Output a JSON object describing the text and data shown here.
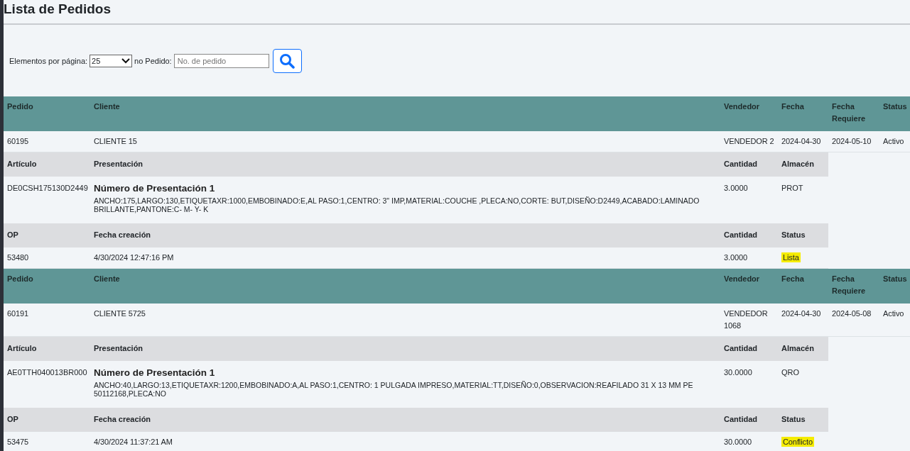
{
  "page_title": "Lista de Pedidos",
  "filters": {
    "per_page_label": "Elementos por página:",
    "per_page_value": "25",
    "order_label": "no Pedido:",
    "order_placeholder": "No. de pedido"
  },
  "orders": [
    {
      "columns": [
        "Pedido",
        "Cliente",
        "Vendedor",
        "Fecha",
        "Fecha Requiere",
        "Status"
      ],
      "row": [
        "60195",
        "CLIENTE 15",
        "VENDEDOR 2",
        "2024-04-30",
        "2024-05-10",
        "Activo"
      ],
      "item_columns": [
        "Artículo",
        "Presentación",
        "Cantidad",
        "Almacén"
      ],
      "items": [
        {
          "articulo": "DE0CSH175130D2449",
          "title": "Número de Presentación 1",
          "detail": "ANCHO:175,LARGO:130,ETIQUETAXR:1000,EMBOBINADO:E,AL PASO:1,CENTRO: 3\" IMP,MATERIAL:COUCHE ,PLECA:NO,CORTE: BUT,DISEÑO:D2449,ACABADO:LAMINADO BRILLANTE,PANTONE:C- M- Y- K",
          "cantidad": "3.0000",
          "almacen": "PROT"
        }
      ],
      "op_columns": [
        "OP",
        "Fecha creación",
        "Cantidad",
        "Status"
      ],
      "ops": [
        {
          "op": "53480",
          "fecha": "4/30/2024 12:47:16 PM",
          "cantidad": "3.0000",
          "status": "Lista",
          "highlighted": true
        }
      ]
    },
    {
      "columns": [
        "Pedido",
        "Cliente",
        "Vendedor",
        "Fecha",
        "Fecha Requiere",
        "Status"
      ],
      "row": [
        "60191",
        "CLIENTE 5725",
        "VENDEDOR 1068",
        "2024-04-30",
        "2024-05-08",
        "Activo"
      ],
      "item_columns": [
        "Artículo",
        "Presentación",
        "Cantidad",
        "Almacén"
      ],
      "items": [
        {
          "articulo": "AE0TTH040013BR000",
          "title": "Número de Presentación 1",
          "detail": "ANCHO:40,LARGO:13,ETIQUETAXR:1200,EMBOBINADO:A,AL PASO:1,CENTRO: 1 PULGADA IMPRESO,MATERIAL:TT,DISEÑO:0,OBSERVACION:REAFILADO 31 X 13 MM PE 50112168,PLECA:NO",
          "cantidad": "30.0000",
          "almacen": "QRO"
        }
      ],
      "op_columns": [
        "OP",
        "Fecha creación",
        "Cantidad",
        "Status"
      ],
      "ops": [
        {
          "op": "53475",
          "fecha": "4/30/2024 11:37:21 AM",
          "cantidad": "30.0000",
          "status": "Conflicto",
          "highlighted": true
        }
      ]
    }
  ]
}
